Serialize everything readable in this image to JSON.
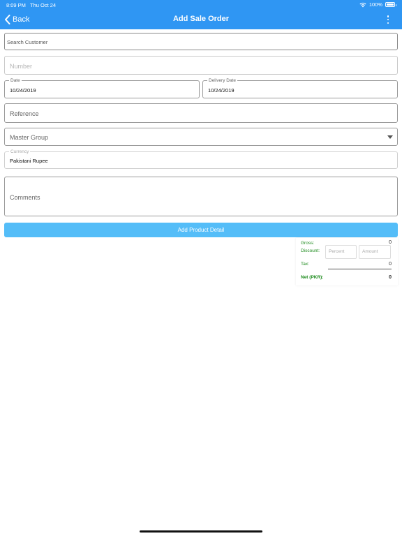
{
  "status_bar": {
    "time": "8:09 PM",
    "date": "Thu Oct 24",
    "battery": "100%",
    "wifi_icon": "wifi-icon",
    "battery_icon": "battery-icon"
  },
  "nav": {
    "back_label": "Back",
    "title": "Add Sale Order",
    "back_icon": "chevron-left-icon",
    "more_icon": "more-vertical-icon"
  },
  "form": {
    "search_customer_placeholder": "Search Customer",
    "number_placeholder": "Number",
    "date_label": "Date",
    "date_value": "10/24/2019",
    "delivery_date_label": "Delivery Date",
    "delivery_date_value": "10/24/2019",
    "reference_placeholder": "Reference",
    "master_group_placeholder": "Master Group",
    "currency_label": "Currency",
    "currency_value": "Pakistani Rupee",
    "comments_placeholder": "Comments"
  },
  "add_product_label": "Add Product Detail",
  "summary": {
    "gross_label": "Gross:",
    "gross_value": "0",
    "discount_label": "Discount:",
    "percent_placeholder": "Percent",
    "amount_placeholder": "Amount",
    "tax_label": "Tax:",
    "tax_value": "0",
    "net_label": "Net (PKR):",
    "net_value": "0"
  },
  "colors": {
    "header": "#2f96f3",
    "button": "#54bdf8",
    "summary_label": "#1b8a1b"
  }
}
